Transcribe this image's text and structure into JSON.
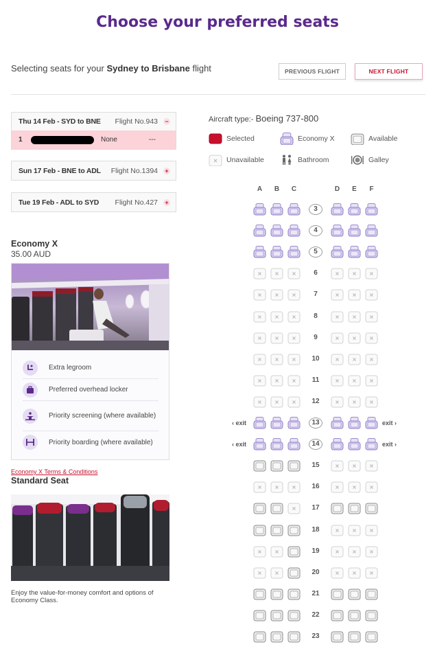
{
  "page": {
    "title": "Choose your preferred seats",
    "subtitle_prefix": "Selecting seats for your ",
    "subtitle_route": "Sydney to Brisbane",
    "subtitle_suffix": " flight",
    "prev_button": "PREVIOUS FLIGHT",
    "next_button": "NEXT FLIGHT"
  },
  "flights": [
    {
      "route": "Thu 14 Feb - SYD to BNE",
      "flight_no": "Flight No.943",
      "toggle": "−",
      "expanded": true,
      "passenger": {
        "num": "1",
        "seat": "None",
        "extra": "---"
      }
    },
    {
      "route": "Sun 17 Feb - BNE to ADL",
      "flight_no": "Flight No.1394",
      "toggle": "+"
    },
    {
      "route": "Tue 19 Feb - ADL to SYD",
      "flight_no": "Flight No.427",
      "toggle": "+"
    }
  ],
  "aircraft": {
    "label": "Aircraft type:- ",
    "type": "Boeing 737-800"
  },
  "legend": {
    "selected": "Selected",
    "economy_x": "Economy X",
    "available": "Available",
    "unavailable": "Unavailable",
    "bathroom": "Bathroom",
    "galley": "Galley"
  },
  "seat_columns": [
    "A",
    "B",
    "C",
    "D",
    "E",
    "F"
  ],
  "exit_label_left": "‹ exit",
  "exit_label_right": "exit ›",
  "seat_rows": [
    {
      "num": "3",
      "seats": "XXXXXX",
      "circled": true
    },
    {
      "num": "4",
      "seats": "XXXXXX",
      "circled": true
    },
    {
      "num": "5",
      "seats": "XXXXXX",
      "circled": true
    },
    {
      "num": "6",
      "seats": "UUUUUU"
    },
    {
      "num": "7",
      "seats": "UUUUUU"
    },
    {
      "num": "8",
      "seats": "UUUUUU"
    },
    {
      "num": "9",
      "seats": "UUUUUU"
    },
    {
      "num": "10",
      "seats": "UUUUUU"
    },
    {
      "num": "11",
      "seats": "UUUUUU"
    },
    {
      "num": "12",
      "seats": "UUUUUU"
    },
    {
      "num": "13",
      "seats": "XXXXXX",
      "circled": true,
      "exit": true
    },
    {
      "num": "14",
      "seats": "XXXXXX",
      "circled": true,
      "exit": true
    },
    {
      "num": "15",
      "seats": "AAAUUU"
    },
    {
      "num": "16",
      "seats": "UUUUUU"
    },
    {
      "num": "17",
      "seats": "AAUAAA"
    },
    {
      "num": "18",
      "seats": "AAAUUU"
    },
    {
      "num": "19",
      "seats": "UUAUUU"
    },
    {
      "num": "20",
      "seats": "UUAUUU"
    },
    {
      "num": "21",
      "seats": "AAAAAA"
    },
    {
      "num": "22",
      "seats": "AAAAAA"
    },
    {
      "num": "23",
      "seats": "AAAAAA"
    }
  ],
  "economy_x": {
    "title": "Economy X",
    "price": "35.00 AUD",
    "features": [
      "Extra legroom",
      "Preferred overhead locker",
      "Priority screening (where available)",
      "Priority boarding (where available)"
    ],
    "terms_link": "Economy X Terms & Conditions"
  },
  "standard": {
    "title": "Standard Seat",
    "description": "Enjoy the value-for-money comfort and options of Economy Class."
  },
  "colors": {
    "brand_purple": "#5a2a8c",
    "accent_red": "#c8102e",
    "economy_x_seat": "#c9bde6",
    "available_seat": "#d8d8d8",
    "selected_seat": "#c8102e"
  }
}
